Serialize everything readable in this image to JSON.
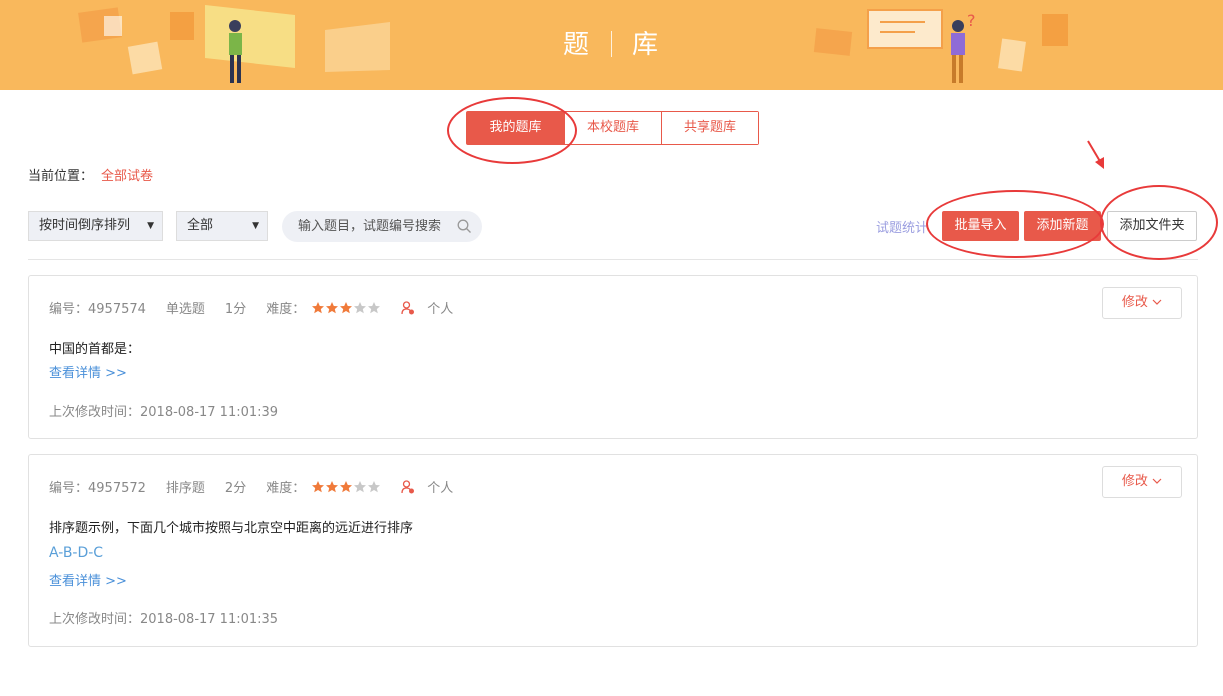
{
  "banner": {
    "title_left": "题",
    "title_right": "库"
  },
  "tabs": [
    {
      "label": "我的题库",
      "active": true
    },
    {
      "label": "本校题库",
      "active": false
    },
    {
      "label": "共享题库",
      "active": false
    }
  ],
  "breadcrumb": {
    "label": "当前位置：",
    "current": "全部试卷"
  },
  "toolbar": {
    "sort_select": "按时间倒序排列",
    "type_select": "全部",
    "search_placeholder": "输入题目，试题编号搜索",
    "stats_link": "试题统计",
    "batch_import": "批量导入",
    "add_question": "添加新题",
    "add_folder": "添加文件夹"
  },
  "questions": [
    {
      "id_text": "编号：4957574",
      "type": "单选题",
      "score": "1分",
      "difficulty_label": "难度：",
      "difficulty": 3,
      "max_difficulty": 5,
      "owner": "个人",
      "edit_label": "修改",
      "text": "中国的首都是：",
      "answer": "",
      "details_link": "查看详情 >>",
      "modified": "上次修改时间：2018-08-17 11:01:39"
    },
    {
      "id_text": "编号：4957572",
      "type": "排序题",
      "score": "2分",
      "difficulty_label": "难度：",
      "difficulty": 3,
      "max_difficulty": 5,
      "owner": "个人",
      "edit_label": "修改",
      "text": "排序题示例，下面几个城市按照与北京空中距离的远近进行排序",
      "answer": "A-B-D-C",
      "details_link": "查看详情 >>",
      "modified": "上次修改时间：2018-08-17 11:01:35"
    }
  ],
  "colors": {
    "accent": "#e8594a",
    "banner": "#f9b85c",
    "link": "#4a90d9",
    "annotation": "#e83a3a"
  }
}
